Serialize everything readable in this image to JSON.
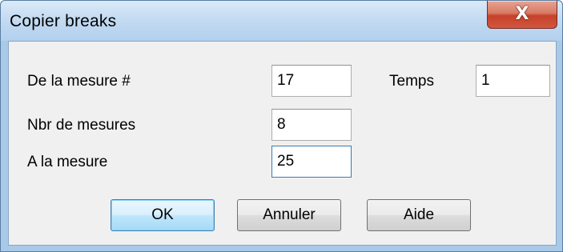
{
  "window": {
    "title": "Copier breaks",
    "close_glyph": "X"
  },
  "form": {
    "from_measure_label": "De la mesure #",
    "from_measure_value": "17",
    "beat_label": "Temps",
    "beat_value": "1",
    "num_measures_label": "Nbr de mesures",
    "num_measures_value": "8",
    "to_measure_label": "A la mesure",
    "to_measure_value": "25"
  },
  "buttons": {
    "ok_label": "OK",
    "cancel_label": "Annuler",
    "help_label": "Aide"
  },
  "colors": {
    "title_bar": "#c4dbf2",
    "close_button": "#c5412a",
    "client_bg": "#f0f0f0",
    "default_button_border": "#3c7fb1"
  },
  "icons": {
    "close": "close-icon"
  }
}
